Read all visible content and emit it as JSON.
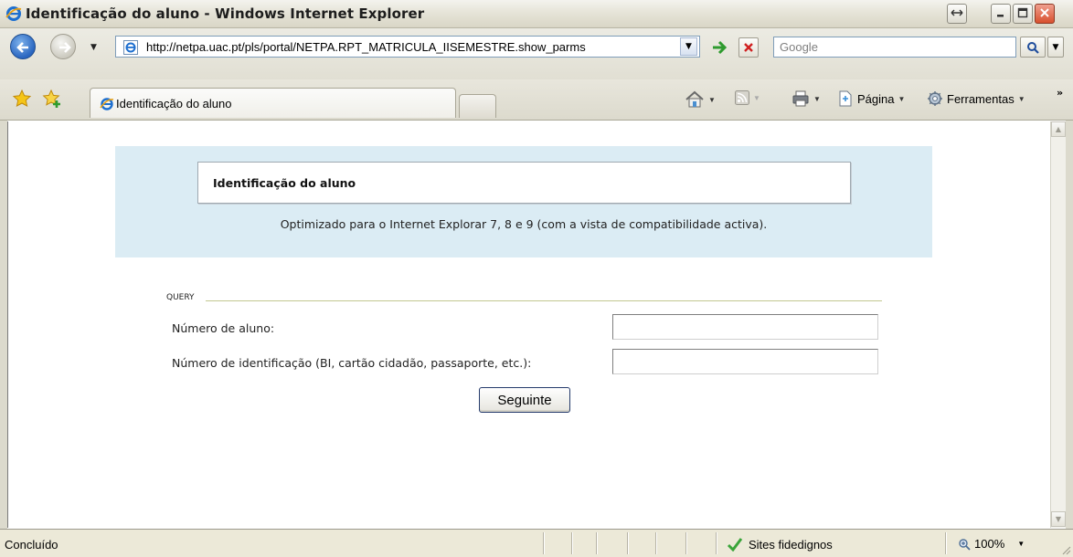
{
  "window": {
    "title": "Identificação do aluno - Windows Internet Explorer"
  },
  "address_bar": {
    "url": "http://netpa.uac.pt/pls/portal/NETPA.RPT_MATRICULA_IISEMESTRE.show_parms",
    "search_placeholder": "Google"
  },
  "tabs": [
    {
      "label": "Identificação do aluno",
      "active": true
    }
  ],
  "commands": {
    "page_label": "Página",
    "tools_label": "Ferramentas"
  },
  "page": {
    "header_title": "Identificação do aluno",
    "note": "Optimizado para o Internet Explorar 7, 8 e 9 (com a vista de compatibilidade activa).",
    "section_label": "QUERY",
    "fields": [
      {
        "label": "Número de aluno:",
        "value": ""
      },
      {
        "label": "Número de identificação (BI, cartão cidadão, passaporte, etc.):",
        "value": ""
      }
    ],
    "submit_label": "Seguinte"
  },
  "status_bar": {
    "status": "Concluído",
    "zone": "Sites fidedignos",
    "zoom": "100%"
  },
  "colors": {
    "hero_background": "#dbecf4",
    "section_rule": "#c2c891",
    "close_button": "#d8502e"
  }
}
